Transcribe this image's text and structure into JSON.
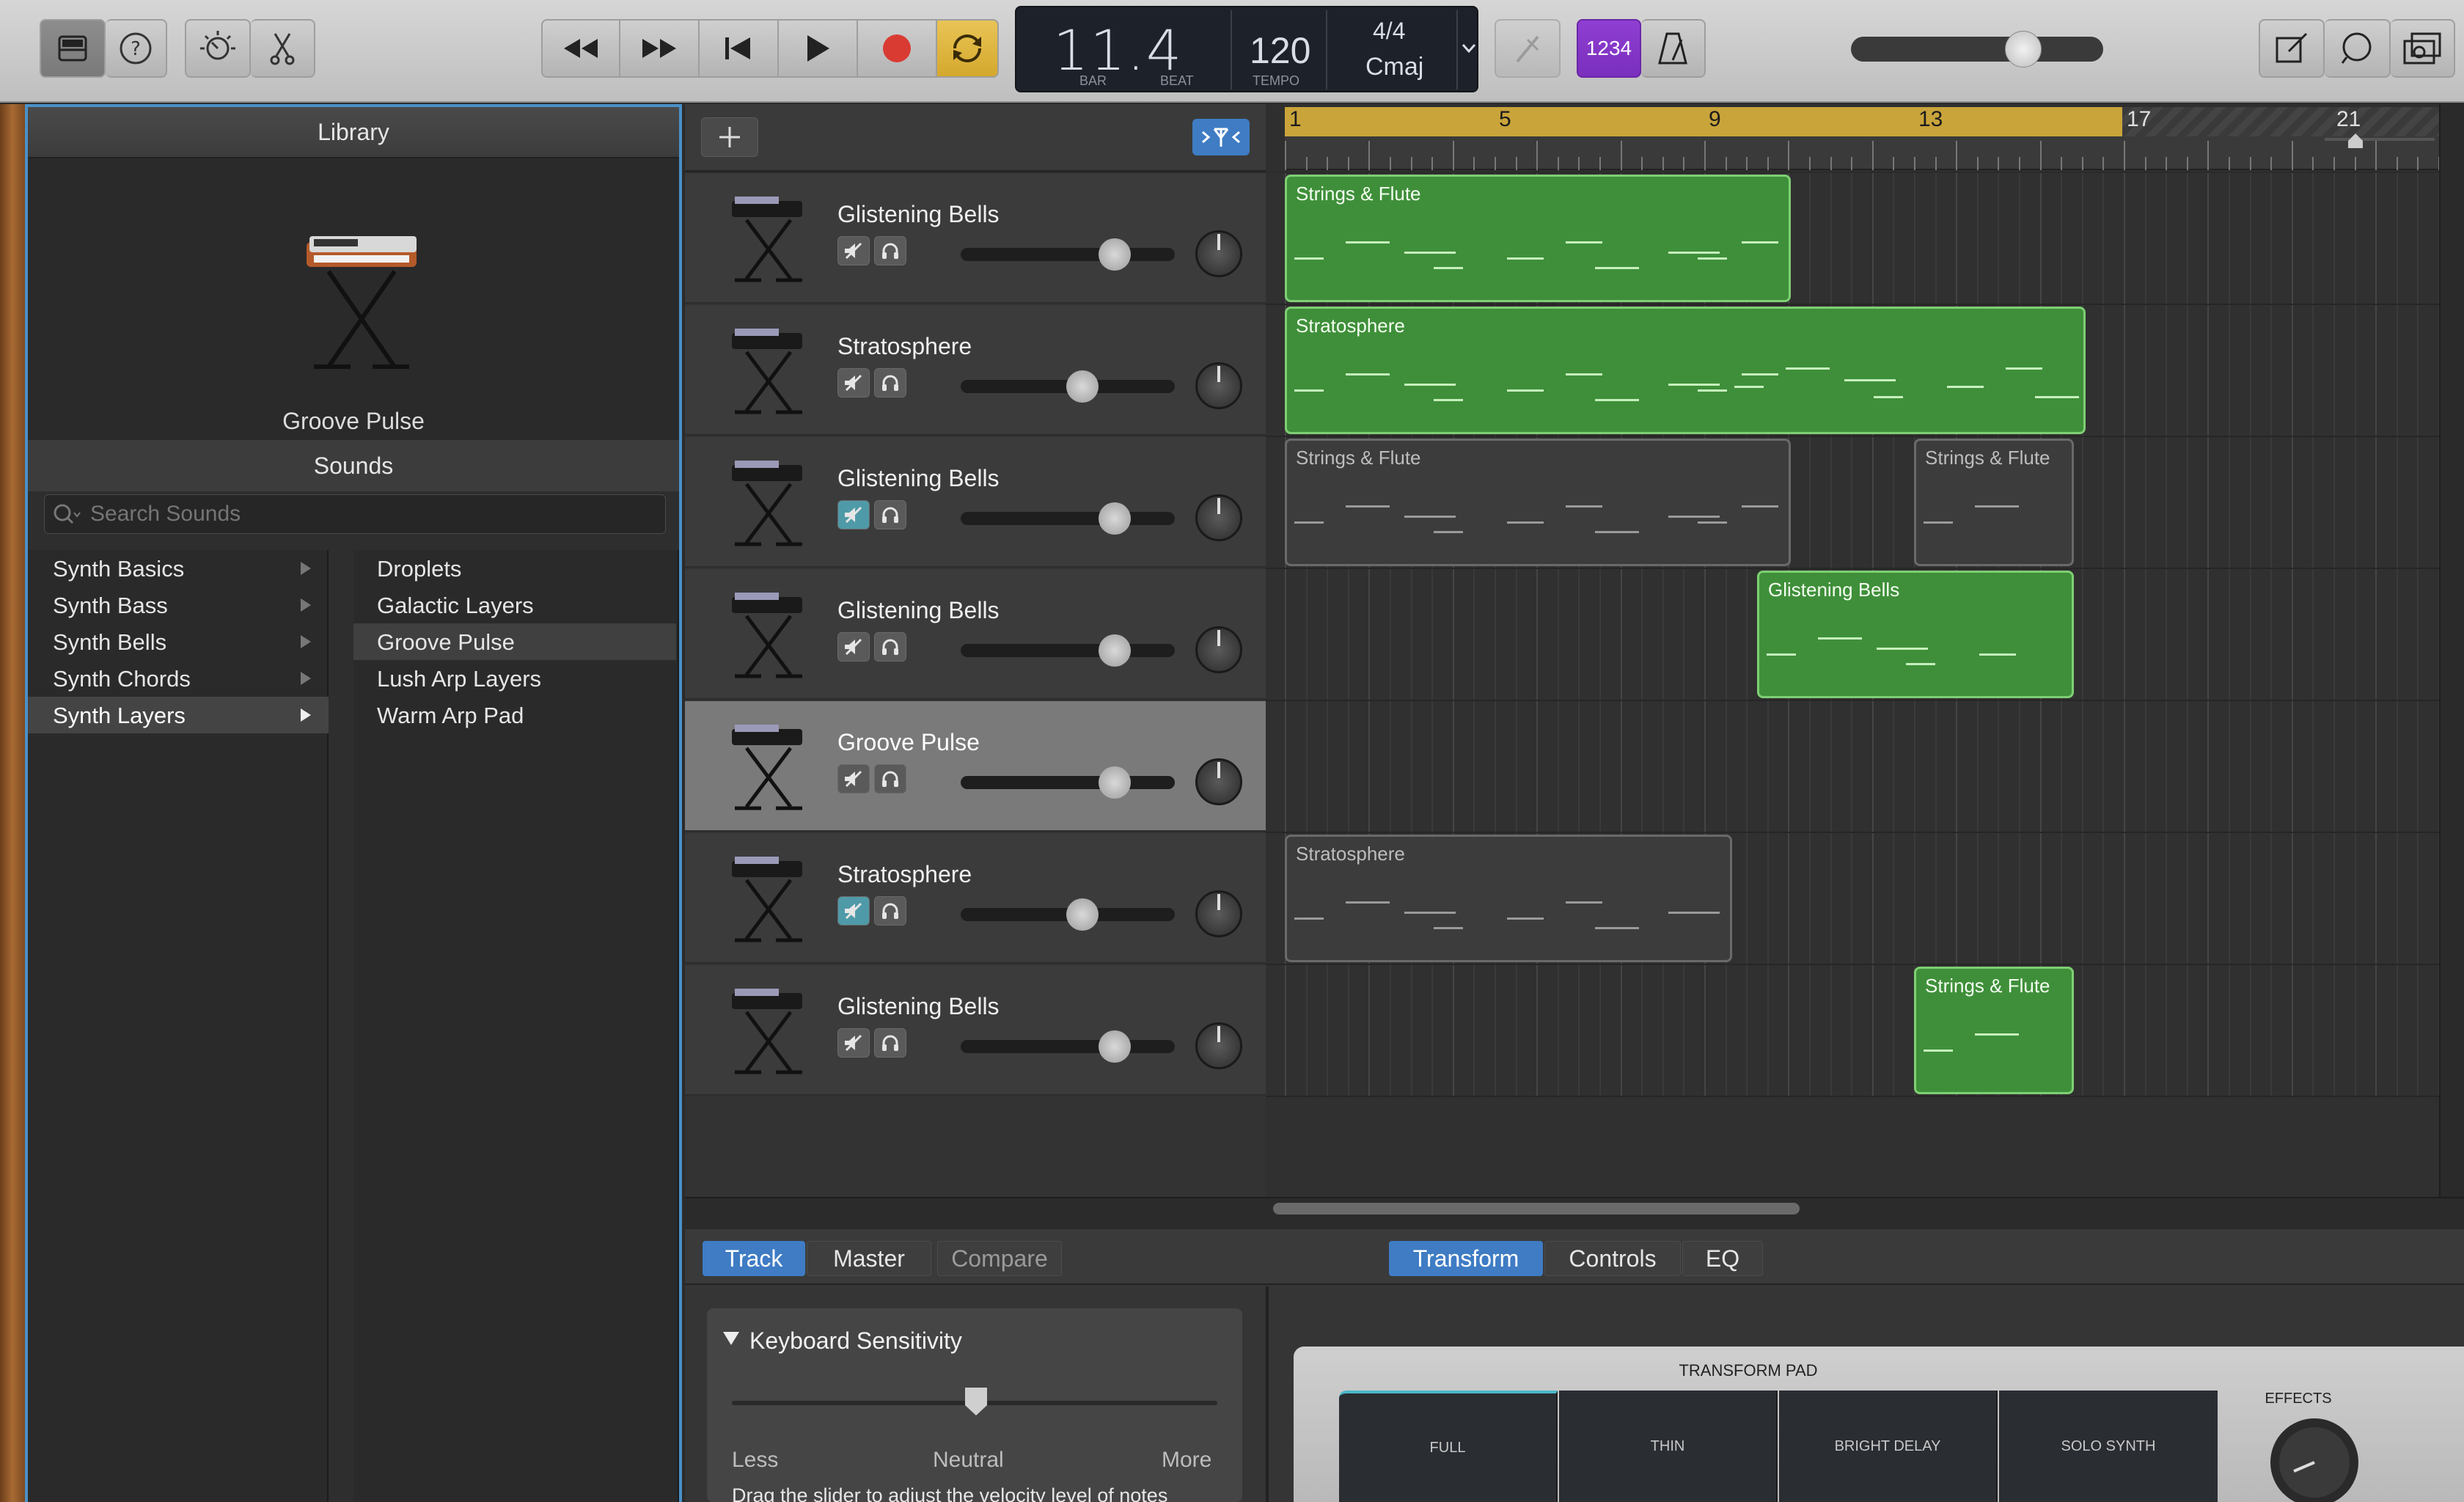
{
  "lcd": {
    "bar_num": "11",
    "dot": ".",
    "beat_num": "4",
    "bar": "BAR",
    "beat": "BEAT",
    "tempo": "120",
    "tempo_label": "TEMPO",
    "sig": "4/4",
    "key": "Cmaj"
  },
  "toolbar": {
    "count_in": "1234"
  },
  "library": {
    "title": "Library",
    "patch": "Groove Pulse",
    "sounds_title": "Sounds",
    "search_placeholder": "Search Sounds",
    "categories": [
      "Synth Basics",
      "Synth Bass",
      "Synth Bells",
      "Synth Chords",
      "Synth Layers"
    ],
    "selected_category": "Synth Layers",
    "patches": [
      "Droplets",
      "Galactic Layers",
      "Groove Pulse",
      "Lush Arp Layers",
      "Warm Arp Pad"
    ],
    "selected_patch": "Groove Pulse"
  },
  "tracks": [
    {
      "name": "Glistening Bells",
      "muted": false,
      "volume": 0.72
    },
    {
      "name": "Stratosphere",
      "muted": false,
      "volume": 0.57
    },
    {
      "name": "Glistening Bells",
      "muted": true,
      "volume": 0.72
    },
    {
      "name": "Glistening Bells",
      "muted": false,
      "volume": 0.72
    },
    {
      "name": "Groove Pulse",
      "muted": false,
      "volume": 0.72,
      "selected": true
    },
    {
      "name": "Stratosphere",
      "muted": true,
      "volume": 0.57
    },
    {
      "name": "Glistening Bells",
      "muted": false,
      "volume": 0.72
    }
  ],
  "ruler": {
    "marks": [
      "1",
      "5",
      "9",
      "13",
      "17",
      "21"
    ]
  },
  "regions": {
    "r1": "Strings & Flute",
    "r2": "Stratosphere",
    "r3": "Strings & Flute",
    "r4": "Strings & Flute",
    "r5": "Glistening Bells",
    "r6": "Stratosphere",
    "r7": "Strings & Flute"
  },
  "bottom": {
    "tabs_left": [
      "Track",
      "Master",
      "Compare"
    ],
    "tabs_right": [
      "Transform",
      "Controls",
      "EQ"
    ],
    "sensitivity_title": "Keyboard Sensitivity",
    "slider_labels": [
      "Less",
      "Neutral",
      "More"
    ],
    "hint": "Drag the slider to adjust the velocity level of notes",
    "transform_pad": "TRANSFORM PAD",
    "pads": [
      "FULL",
      "THIN",
      "BRIGHT DELAY",
      "SOLO SYNTH"
    ],
    "effects": "EFFECTS"
  },
  "colors": {
    "accent": "#3f7cc4",
    "region_green": "#3f8f3a",
    "record": "#d93b32",
    "cycle": "#e3b73a"
  }
}
